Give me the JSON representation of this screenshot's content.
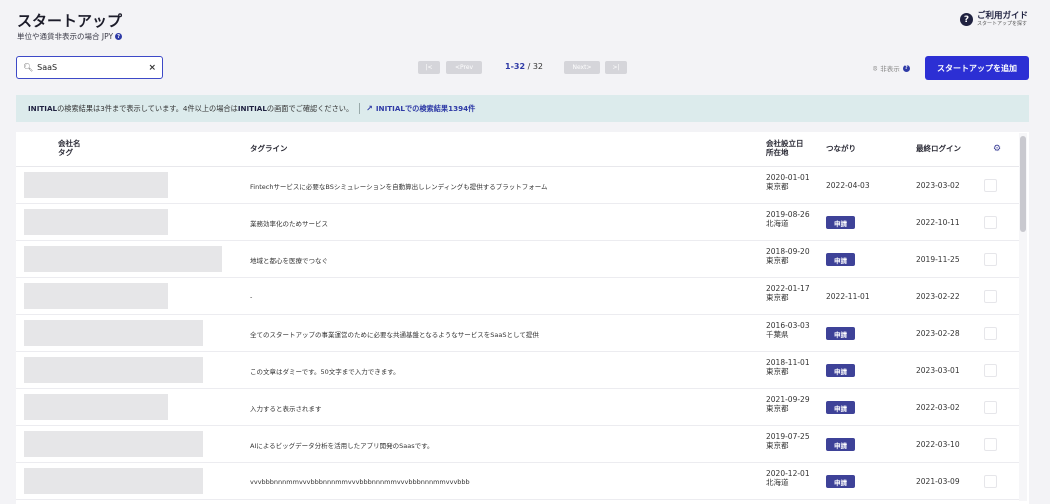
{
  "header": {
    "title": "スタートアップ",
    "subtitle": "単位や通貨非表示の場合 JPY",
    "guide_title": "ご利用ガイド",
    "guide_sub": "スタートアップを探す"
  },
  "search": {
    "value": "SaaS",
    "icon": "search-icon",
    "clear": "×"
  },
  "pagination": {
    "first": "|<",
    "prev": "<Prev",
    "range": "1-32",
    "total": "/ 32",
    "next": "Next>",
    "last": ">|"
  },
  "toolbar": {
    "hidden_label": "非表示",
    "add_label": "スタートアップを追加",
    "accent": "#2c2fd4"
  },
  "banner": {
    "bold1": "INITIAL",
    "text1": "の検索結果は3件まで表示しています。4件以上の場合は",
    "bold2": "INITIAL",
    "text2": "の画面でご確認ください。",
    "link": "INITIALでの検索結果1394件"
  },
  "table": {
    "headers": {
      "company": "会社名",
      "tag": "タグ",
      "tagline": "タグライン",
      "established": "会社設立日",
      "location": "所在地",
      "connection": "つながり",
      "last_login": "最終ログイン"
    },
    "badge_label": "申請",
    "rows": [
      {
        "tagline": "Fintechサービスに必要なBSシミュレーションを自動算出しレンディングも提供するプラットフォーム",
        "date": "2020-01-01",
        "location": "東京都",
        "connection": "2022-04-03",
        "badge": false,
        "login": "2023-03-02"
      },
      {
        "tagline": "業務効率化のためサービス",
        "date": "2019-08-26",
        "location": "北海道",
        "connection": "",
        "badge": true,
        "login": "2022-10-11"
      },
      {
        "tagline": "地域と都心を医療でつなぐ",
        "date": "2018-09-20",
        "location": "東京都",
        "connection": "",
        "badge": true,
        "login": "2019-11-25"
      },
      {
        "tagline": "-",
        "date": "2022-01-17",
        "location": "東京都",
        "connection": "2022-11-01",
        "badge": false,
        "login": "2023-02-22"
      },
      {
        "tagline": "全てのスタートアップの事業運営のために必要な共通基盤となるようなサービスをSaaSとして提供",
        "date": "2016-03-03",
        "location": "千葉県",
        "connection": "",
        "badge": true,
        "login": "2023-02-28"
      },
      {
        "tagline": "この文章はダミーです。50文字まで入力できます。",
        "date": "2018-11-01",
        "location": "東京都",
        "connection": "",
        "badge": true,
        "login": "2023-03-01"
      },
      {
        "tagline": "入力すると表示されます",
        "date": "2021-09-29",
        "location": "東京都",
        "connection": "",
        "badge": true,
        "login": "2022-03-02"
      },
      {
        "tagline": "AIによるビッグデータ分析を活用したアプリ開発のSaasです。",
        "date": "2019-07-25",
        "location": "東京都",
        "connection": "",
        "badge": true,
        "login": "2022-03-10"
      },
      {
        "tagline": "vvvbbbnnnmmvvvbbbnnnmmvvvbbbnnnmmvvvbbbnnnmmvvvbbb",
        "date": "2020-12-01",
        "location": "北海道",
        "connection": "",
        "badge": true,
        "login": "2021-03-09"
      }
    ]
  }
}
